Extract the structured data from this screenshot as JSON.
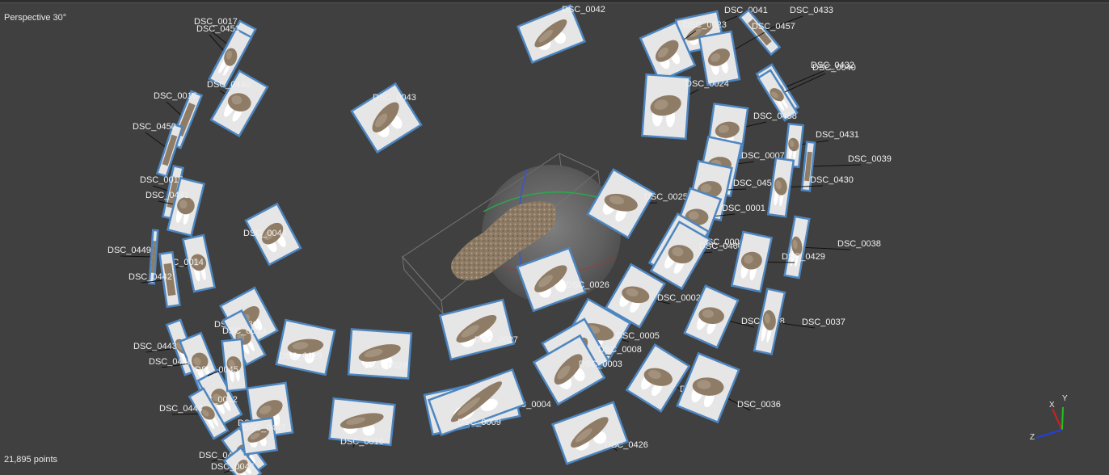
{
  "viewport": {
    "view_mode": "Perspective 30°",
    "point_count": "21,895 points"
  },
  "cameras": [
    {
      "label": "DSC_0017"
    },
    {
      "label": "DSC_0451"
    },
    {
      "label": "DSC_0440"
    },
    {
      "label": "DSC_0016"
    },
    {
      "label": "DSC_0450"
    },
    {
      "label": "DSC_0015"
    },
    {
      "label": "DSC_0441"
    },
    {
      "label": "DSC_0449"
    },
    {
      "label": "DSC_0014"
    },
    {
      "label": "DSC_0442"
    },
    {
      "label": "DSC_0443"
    },
    {
      "label": "DSC_0448"
    },
    {
      "label": "DSC_0012"
    },
    {
      "label": "DSC_0444"
    },
    {
      "label": "DSC_0445"
    },
    {
      "label": "DSC_0046"
    },
    {
      "label": "DSC_0043"
    },
    {
      "label": "DSC_0044"
    },
    {
      "label": "DSC_0030"
    },
    {
      "label": "DSC_0013"
    },
    {
      "label": "DSC_0029"
    },
    {
      "label": "DSC_0045"
    },
    {
      "label": "DSC_0028"
    },
    {
      "label": "DSC_0011"
    },
    {
      "label": "DSC_0447"
    },
    {
      "label": "DSC_0010"
    },
    {
      "label": "DSC_0042"
    },
    {
      "label": "DSC_0041"
    },
    {
      "label": "DSC_0433"
    },
    {
      "label": "DSC_0023"
    },
    {
      "label": "DSC_0457"
    },
    {
      "label": "DSC_0024"
    },
    {
      "label": "DSC_0432"
    },
    {
      "label": "DSC_0040"
    },
    {
      "label": "DSC_0458"
    },
    {
      "label": "DSC_0431"
    },
    {
      "label": "DSC_0007"
    },
    {
      "label": "DSC_0039"
    },
    {
      "label": "DSC_0459"
    },
    {
      "label": "DSC_0430"
    },
    {
      "label": "DSC_0025"
    },
    {
      "label": "DSC_0001"
    },
    {
      "label": "DSC_0006"
    },
    {
      "label": "DSC_0460"
    },
    {
      "label": "DSC_0038"
    },
    {
      "label": "DSC_0429"
    },
    {
      "label": "DSC_0026"
    },
    {
      "label": "DSC_0002"
    },
    {
      "label": "DSC_0428"
    },
    {
      "label": "DSC_0037"
    },
    {
      "label": "DSC_0027"
    },
    {
      "label": "DSC_0005"
    },
    {
      "label": "DSC_0008"
    },
    {
      "label": "DSC_0003"
    },
    {
      "label": "DSC_0427"
    },
    {
      "label": "DSC_0004"
    },
    {
      "label": "DSC_0036"
    },
    {
      "label": "DSC_0009"
    },
    {
      "label": "DSC_0426"
    }
  ],
  "gizmo": {
    "x_label": "X",
    "y_label": "Y",
    "z_label": "Z",
    "x_color": "#d22020",
    "y_color": "#22c022",
    "z_color": "#2040e0"
  },
  "colors": {
    "background": "#404040",
    "camera_frame": "#4d86c0",
    "label": "#f0f0f0"
  }
}
